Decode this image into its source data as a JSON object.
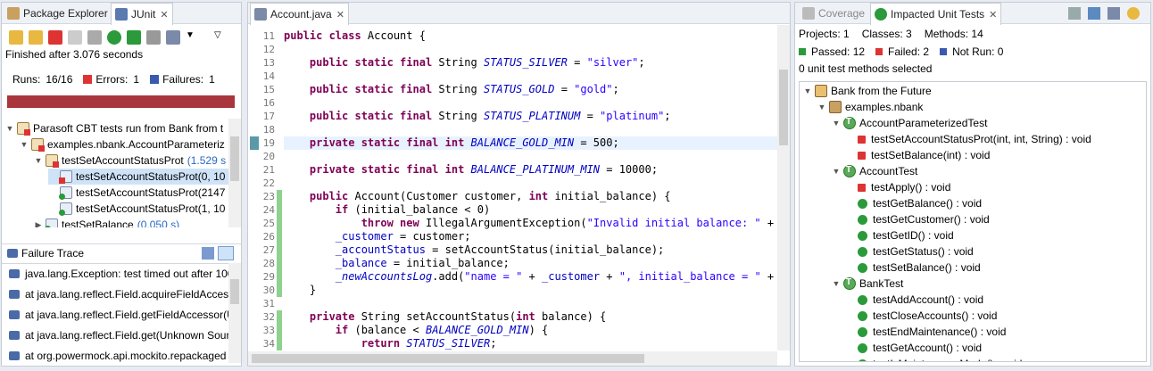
{
  "left": {
    "tabs": [
      {
        "label": "Package Explorer"
      },
      {
        "label": "JUnit"
      }
    ],
    "status": "Finished after 3.076 seconds",
    "counts": {
      "runs_label": "Runs:",
      "runs": "16/16",
      "errors_label": "Errors:",
      "errors": "1",
      "failures_label": "Failures:",
      "failures": "1"
    },
    "tree": [
      {
        "label": "Parasoft CBT tests run from Bank from t",
        "time": "",
        "depth": 0,
        "icon": "suite",
        "expand": "▼"
      },
      {
        "label": "examples.nbank.AccountParameteriz",
        "time": "",
        "depth": 1,
        "icon": "suite",
        "expand": "▼"
      },
      {
        "label": "testSetAccountStatusProt",
        "time": "(1.529 s",
        "depth": 2,
        "icon": "suite",
        "expand": "▼"
      },
      {
        "label": "testSetAccountStatusProt(0, 10",
        "time": "",
        "depth": 3,
        "icon": "err",
        "expand": ""
      },
      {
        "label": "testSetAccountStatusProt(2147",
        "time": "",
        "depth": 3,
        "icon": "ok",
        "expand": ""
      },
      {
        "label": "testSetAccountStatusProt(1, 10",
        "time": "",
        "depth": 3,
        "icon": "ok",
        "expand": ""
      },
      {
        "label": "testSetBalance",
        "time": "(0.050 s)",
        "depth": 2,
        "icon": "ok",
        "expand": "▶"
      }
    ],
    "failure_trace": {
      "title": "Failure Trace",
      "lines": [
        "java.lang.Exception: test timed out after 100",
        "at java.lang.reflect.Field.acquireFieldAccess",
        "at java.lang.reflect.Field.getFieldAccessor(U",
        "at java.lang.reflect.Field.get(Unknown Sour",
        "at org.powermock.api.mockito.repackaged"
      ]
    }
  },
  "editor": {
    "tab": "Account.java",
    "lines": [
      {
        "n": "11",
        "parts": [
          [
            "kw",
            "public class "
          ],
          [
            "",
            "Account {"
          ]
        ]
      },
      {
        "n": "12",
        "parts": []
      },
      {
        "n": "13",
        "parts": [
          [
            "",
            "    "
          ],
          [
            "kw",
            "public static final "
          ],
          [
            "",
            "String "
          ],
          [
            "st",
            "STATUS_SILVER"
          ],
          [
            "",
            " = "
          ],
          [
            "str",
            "\"silver\""
          ],
          [
            "",
            ";"
          ]
        ]
      },
      {
        "n": "14",
        "parts": []
      },
      {
        "n": "15",
        "parts": [
          [
            "",
            "    "
          ],
          [
            "kw",
            "public static final "
          ],
          [
            "",
            "String "
          ],
          [
            "st",
            "STATUS_GOLD"
          ],
          [
            "",
            " = "
          ],
          [
            "str",
            "\"gold\""
          ],
          [
            "",
            ";"
          ]
        ]
      },
      {
        "n": "16",
        "parts": []
      },
      {
        "n": "17",
        "parts": [
          [
            "",
            "    "
          ],
          [
            "kw",
            "public static final "
          ],
          [
            "",
            "String "
          ],
          [
            "st",
            "STATUS_PLATINUM"
          ],
          [
            "",
            " = "
          ],
          [
            "str",
            "\"platinum\""
          ],
          [
            "",
            ";"
          ]
        ]
      },
      {
        "n": "18",
        "parts": []
      },
      {
        "n": "19",
        "parts": [
          [
            "",
            "    "
          ],
          [
            "kw",
            "private static final int "
          ],
          [
            "st",
            "BALANCE_GOLD_MIN"
          ],
          [
            "",
            " = 500;"
          ]
        ],
        "hl": true
      },
      {
        "n": "20",
        "parts": []
      },
      {
        "n": "21",
        "parts": [
          [
            "",
            "    "
          ],
          [
            "kw",
            "private static final int "
          ],
          [
            "st",
            "BALANCE_PLATINUM_MIN"
          ],
          [
            "",
            " = 10000;"
          ]
        ]
      },
      {
        "n": "22",
        "parts": []
      },
      {
        "n": "23",
        "parts": [
          [
            "",
            "    "
          ],
          [
            "kw",
            "public "
          ],
          [
            "",
            "Account(Customer customer, "
          ],
          [
            "kw",
            "int "
          ],
          [
            "",
            "initial_balance) {"
          ]
        ],
        "cov": true
      },
      {
        "n": "24",
        "parts": [
          [
            "",
            "        "
          ],
          [
            "kw",
            "if "
          ],
          [
            "",
            "(initial_balance < 0)"
          ]
        ],
        "cov": true
      },
      {
        "n": "25",
        "parts": [
          [
            "",
            "            "
          ],
          [
            "kw",
            "throw new "
          ],
          [
            "",
            "IllegalArgumentException("
          ],
          [
            "str",
            "\"Invalid initial balance: \""
          ],
          [
            "",
            " +"
          ]
        ],
        "cov": true
      },
      {
        "n": "26",
        "parts": [
          [
            "",
            "        "
          ],
          [
            "fld",
            "_customer"
          ],
          [
            "",
            " = customer;"
          ]
        ],
        "cov": true
      },
      {
        "n": "27",
        "parts": [
          [
            "",
            "        "
          ],
          [
            "fld",
            "_accountStatus"
          ],
          [
            "",
            " = setAccountStatus(initial_balance);"
          ]
        ],
        "cov": true
      },
      {
        "n": "28",
        "parts": [
          [
            "",
            "        "
          ],
          [
            "fld",
            "_balance"
          ],
          [
            "",
            " = initial_balance;"
          ]
        ],
        "cov": true
      },
      {
        "n": "29",
        "parts": [
          [
            "",
            "        "
          ],
          [
            "st",
            "_newAccountsLog"
          ],
          [
            "",
            ".add("
          ],
          [
            "str",
            "\"name = \""
          ],
          [
            "",
            " + "
          ],
          [
            "fld",
            "_customer"
          ],
          [
            "",
            " + "
          ],
          [
            "str",
            "\", initial_balance = \""
          ],
          [
            "",
            " +"
          ]
        ],
        "cov": true
      },
      {
        "n": "30",
        "parts": [
          [
            "",
            "    }"
          ]
        ],
        "cov": true
      },
      {
        "n": "31",
        "parts": []
      },
      {
        "n": "32",
        "parts": [
          [
            "",
            "    "
          ],
          [
            "kw",
            "private "
          ],
          [
            "",
            "String setAccountStatus("
          ],
          [
            "kw",
            "int "
          ],
          [
            "",
            "balance) {"
          ]
        ],
        "cov": true
      },
      {
        "n": "33",
        "parts": [
          [
            "",
            "        "
          ],
          [
            "kw",
            "if "
          ],
          [
            "",
            "(balance < "
          ],
          [
            "st",
            "BALANCE_GOLD_MIN"
          ],
          [
            "",
            ") {"
          ]
        ],
        "cov": true
      },
      {
        "n": "34",
        "parts": [
          [
            "",
            "            "
          ],
          [
            "kw",
            "return "
          ],
          [
            "st",
            "STATUS_SILVER"
          ],
          [
            "",
            ";"
          ]
        ],
        "cov": true
      }
    ]
  },
  "right": {
    "tabs": [
      {
        "label": "Coverage"
      },
      {
        "label": "Impacted Unit Tests"
      }
    ],
    "stats1": {
      "projects": "Projects: 1",
      "classes": "Classes: 3",
      "methods": "Methods: 14"
    },
    "stats2": {
      "passed": "Passed: 12",
      "failed": "Failed: 2",
      "notrun": "Not Run: 0"
    },
    "selected": "0 unit test methods selected",
    "tree": [
      {
        "label": "Bank from the Future",
        "depth": 0,
        "icon": "proj"
      },
      {
        "label": "examples.nbank",
        "depth": 1,
        "icon": "pkg"
      },
      {
        "label": "AccountParameterizedTest",
        "depth": 2,
        "icon": "cls"
      },
      {
        "label": "testSetAccountStatusProt(int, int, String) : void",
        "depth": 3,
        "icon": "mfail"
      },
      {
        "label": "testSetBalance(int) : void",
        "depth": 3,
        "icon": "mfail"
      },
      {
        "label": "AccountTest",
        "depth": 2,
        "icon": "cls"
      },
      {
        "label": "testApply() : void",
        "depth": 3,
        "icon": "mfail"
      },
      {
        "label": "testGetBalance() : void",
        "depth": 3,
        "icon": "mok"
      },
      {
        "label": "testGetCustomer() : void",
        "depth": 3,
        "icon": "mok"
      },
      {
        "label": "testGetID() : void",
        "depth": 3,
        "icon": "mok"
      },
      {
        "label": "testGetStatus() : void",
        "depth": 3,
        "icon": "mok"
      },
      {
        "label": "testSetBalance() : void",
        "depth": 3,
        "icon": "mok"
      },
      {
        "label": "BankTest",
        "depth": 2,
        "icon": "cls"
      },
      {
        "label": "testAddAccount() : void",
        "depth": 3,
        "icon": "mok"
      },
      {
        "label": "testCloseAccounts() : void",
        "depth": 3,
        "icon": "mok"
      },
      {
        "label": "testEndMaintenance() : void",
        "depth": 3,
        "icon": "mok"
      },
      {
        "label": "testGetAccount() : void",
        "depth": 3,
        "icon": "mok"
      },
      {
        "label": "testIsMaintenanceMode() : void",
        "depth": 3,
        "icon": "mok"
      }
    ]
  },
  "colors": {
    "failure_bar": "#a8363c",
    "coverage": "#8fd18f",
    "keyword": "#7f0055",
    "string": "#2a00ff",
    "field": "#0000c0"
  }
}
